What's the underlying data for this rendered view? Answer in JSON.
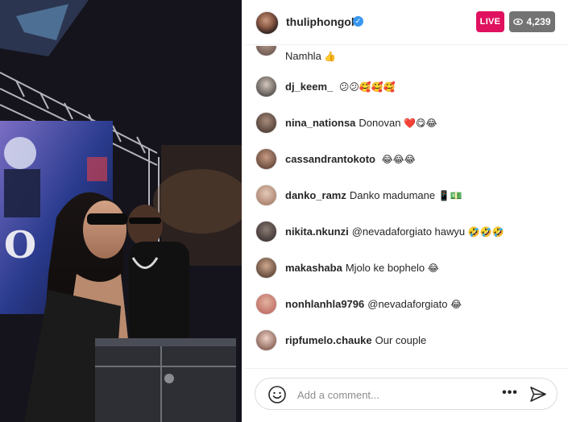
{
  "header": {
    "username": "thuliphongolo",
    "verified_mark": "✓",
    "live_label": "LIVE",
    "viewer_count": "4,239",
    "accent_live": "#e0115f"
  },
  "comments": {
    "partial": {
      "text": "Namhla"
    },
    "items": [
      {
        "username": "dj_keem_",
        "text": "",
        "emojis": "😕😕🥰🥰🥰"
      },
      {
        "username": "nina_nationsa",
        "text": "Donovan",
        "emojis": "❤️😋😂"
      },
      {
        "username": "cassandrantokoto",
        "text": "",
        "emojis": "😂😂😂"
      },
      {
        "username": "danko_ramz",
        "text": "Danko madumane",
        "emojis": "📱💵"
      },
      {
        "username": "nikita.nkunzi",
        "text": "@nevadaforgiato hawyu",
        "emojis": "🤣🤣🤣"
      },
      {
        "username": "makashaba",
        "text": "Mjolo ke bophelo",
        "emojis": "😂"
      },
      {
        "username": "nonhlanhla9796",
        "text": "@nevadaforgiato",
        "emojis": "😂"
      },
      {
        "username": "ripfumelo.chauke",
        "text": "Our couple",
        "emojis": ""
      }
    ]
  },
  "footer": {
    "placeholder": "Add a comment...",
    "more_label": "•••"
  },
  "icons": [
    "eye-icon",
    "verified-icon",
    "smile-icon",
    "more-icon",
    "send-icon"
  ]
}
